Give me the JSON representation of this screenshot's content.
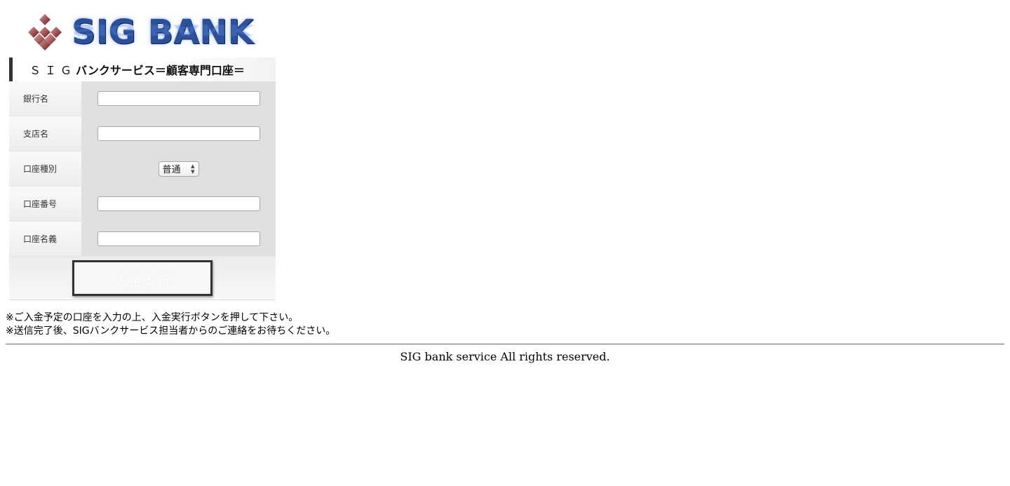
{
  "logo": {
    "text": "SIG BANK",
    "icon": "diamond-cluster-icon",
    "text_color": "#2c4f9a",
    "mark_color": "#7a1a1a"
  },
  "form": {
    "title_prefix": "ＳＩＧ",
    "title_main": "バンクサービス＝顧客専門口座＝",
    "fields": {
      "bank_name": {
        "label": "銀行名",
        "value": ""
      },
      "branch_name": {
        "label": "支店名",
        "value": ""
      },
      "account_type": {
        "label": "口座種別",
        "selected": "普通"
      },
      "account_number": {
        "label": "口座番号",
        "value": ""
      },
      "account_holder": {
        "label": "口座名義",
        "value": ""
      }
    },
    "submit_label": "入金実行"
  },
  "notes": [
    "※ご入金予定の口座を入力の上、入金実行ボタンを押して下さい。",
    "※送信完了後、SIGバンクサービス担当者からのご連絡をお待ちください。"
  ],
  "footer": {
    "text": "SIG bank service All rights reserved."
  }
}
